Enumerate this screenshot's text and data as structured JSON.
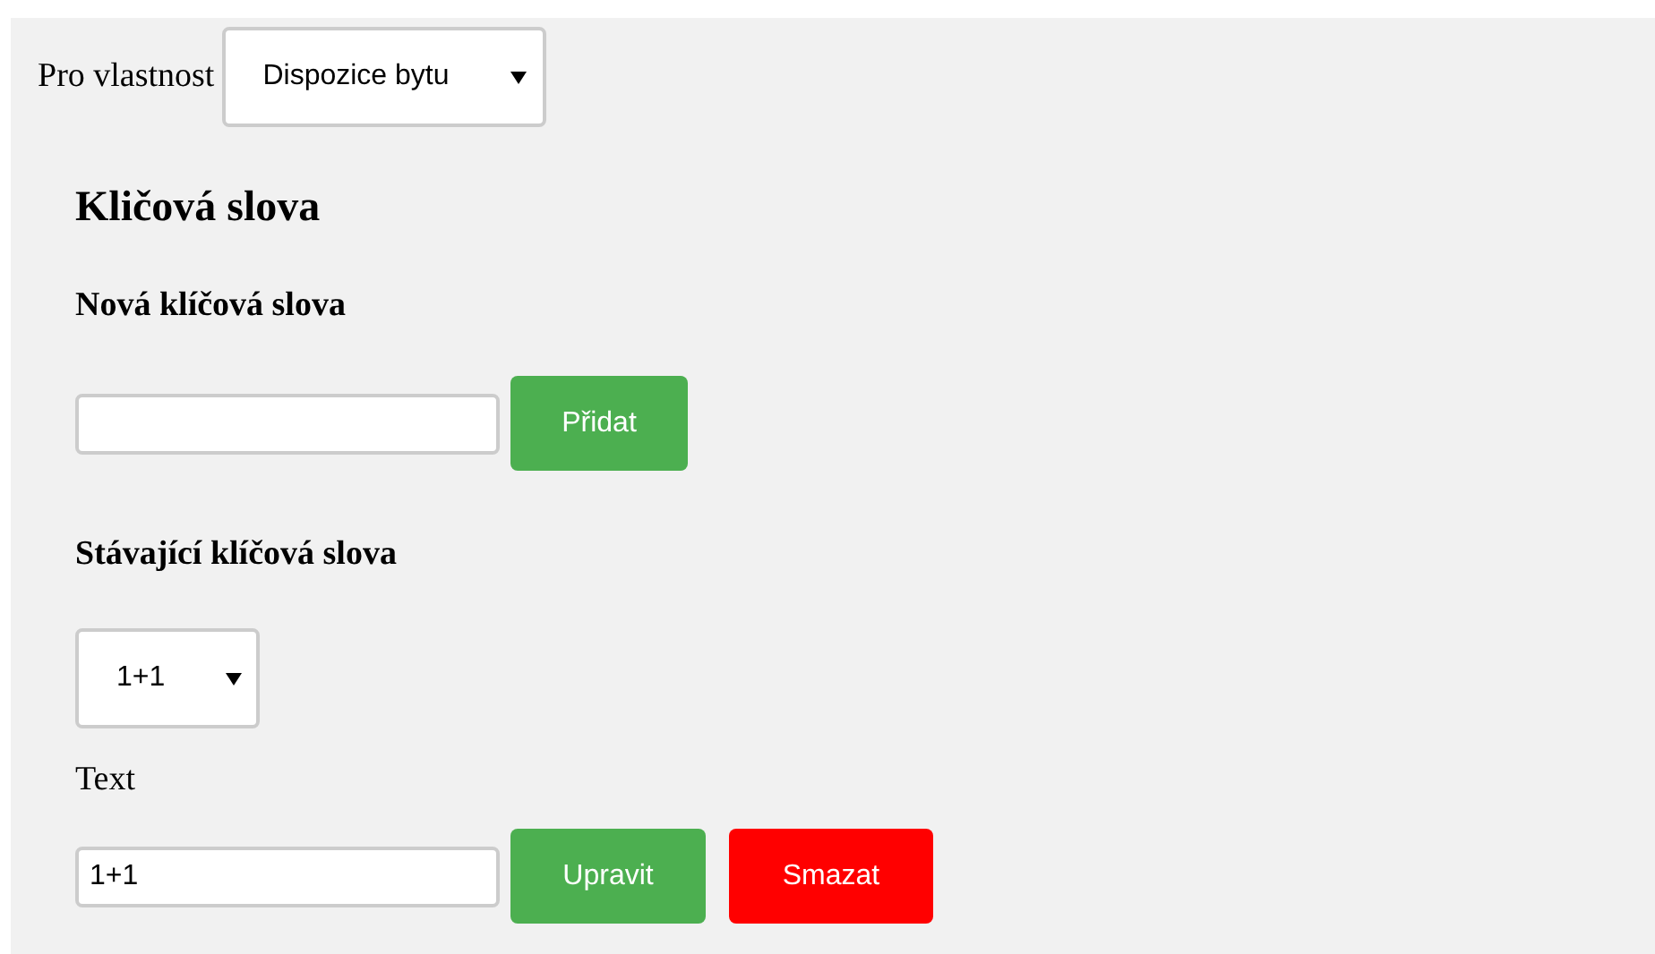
{
  "property": {
    "label": "Pro vlastnost",
    "value": "Dispozice bytu"
  },
  "section_title": "Kličová slova",
  "new_keywords": {
    "title": "Nová klíčová slova",
    "buttons": [
      {
        "label": "Přidat",
        "kind": "confirm"
      }
    ]
  },
  "existing_keywords": {
    "title": "Stávající klíčová slova",
    "selected_value": "1+1",
    "text_label": "Text",
    "value": "1+1",
    "buttons": [
      {
        "label": "Upravit",
        "kind": "confirm"
      },
      {
        "label": "Smazat",
        "kind": "danger"
      }
    ]
  }
}
